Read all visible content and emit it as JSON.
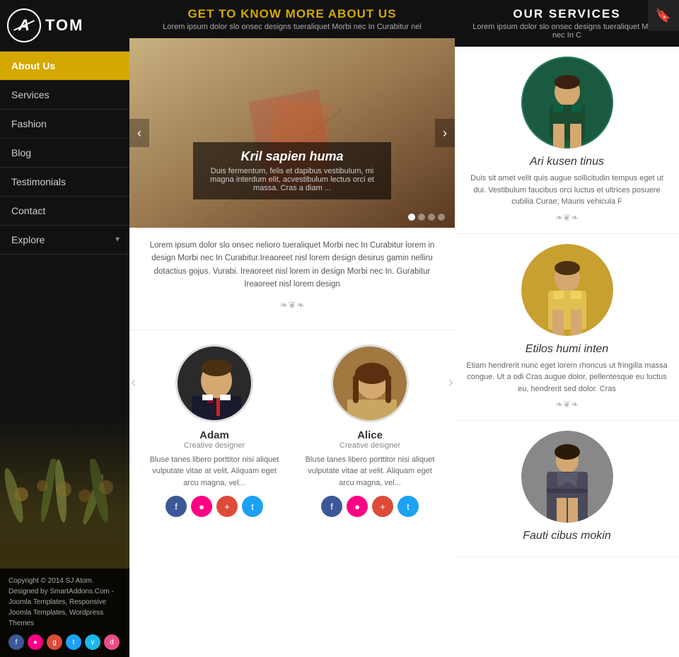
{
  "logo": {
    "letter": "A",
    "text": "TOM"
  },
  "nav": {
    "items": [
      {
        "label": "About Us",
        "active": true,
        "arrow": false
      },
      {
        "label": "Services",
        "active": false,
        "arrow": false
      },
      {
        "label": "Fashion",
        "active": false,
        "arrow": false
      },
      {
        "label": "Blog",
        "active": false,
        "arrow": false
      },
      {
        "label": "Testimonials",
        "active": false,
        "arrow": false
      },
      {
        "label": "Contact",
        "active": false,
        "arrow": false
      },
      {
        "label": "Explore",
        "active": false,
        "arrow": true
      }
    ]
  },
  "copyright": {
    "text": "Copyright © 2014 SJ Atom. Designed by SmartAddons.Com - Joomla Templates, Responsive Joomla Templates, Wordpress Themes"
  },
  "main_header": {
    "title": "GET TO KNOW MORE ABOUT US",
    "subtitle": "Lorem ipsum dolor slo onsec designs tueraliquet Morbi nec In Curabitur nel"
  },
  "slider": {
    "caption_title": "Kril sapien huma",
    "caption_text": "Duis fermentum, felis et dapibus vestibulum, mi magna interdum elit, acvestibulum lectus orci et massa. Cras a diam ...",
    "dots": [
      1,
      2,
      3,
      4
    ],
    "active_dot": 1
  },
  "about_text": "Lorem ipsum dolor slo onsec nelioro tueraliquet Morbi nec In Curabitur lorem in design Morbi nec In Curabitur.Ireaoreet nisl lorem design desirus gamin nelliru dotactius gojus. Vurabi. Ireaoreet nisl lorem in design Morbi nec In. Gurabitur Ireaoreet nisl lorem design",
  "divider": "❧❦❧",
  "team": {
    "members": [
      {
        "name": "Adam",
        "role": "Creative designer",
        "bio": "Bluse tanes libero porttitor nisi aliquet vulputate vitae at velit. Aliquam eget arcu magna, vel...",
        "gender": "male"
      },
      {
        "name": "Alice",
        "role": "Creative designer",
        "bio": "Bluse tanes libero porttitor nisi aliquet vulputate vitae at velit. Aliquam eget arcu magna, vel...",
        "gender": "female"
      }
    ]
  },
  "right_header": {
    "title": "OUR SERVICES",
    "subtitle": "Lorem ipsum dolor slo onsec designs tueraliquet Morbi nec In C",
    "icon": "✦"
  },
  "services": [
    {
      "title": "Ari kusen tinus",
      "desc": "Duis sit amet velit quis augue sollicitudin tempus eget ut dui. Vestibulum faucibus orci luctus et ultrices posuere cubilia Curae; Mauris vehicula F"
    },
    {
      "title": "Etilos humi inten",
      "desc": "Etiam hendrerit nunc eget lorem rhoncus ut fringilla massa congue. Ut a odi Cras augue dolor, pellentesque eu luctus eu, hendrerit sed dolor. Cras"
    },
    {
      "title": "Fauti cibus mokin",
      "desc": ""
    }
  ]
}
